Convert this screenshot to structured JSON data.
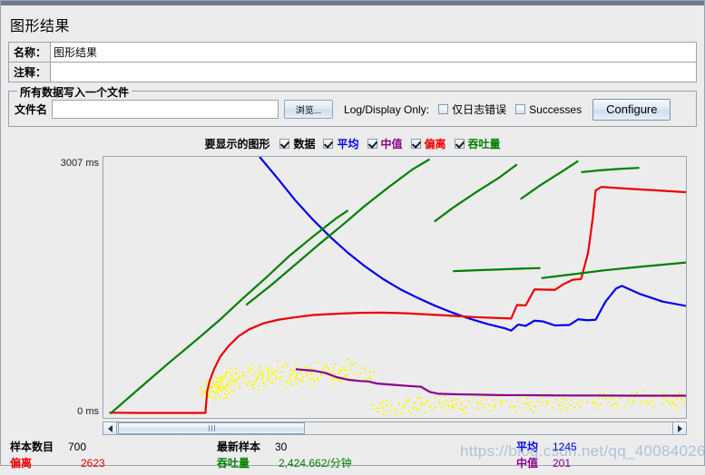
{
  "window": {
    "title": "图形结果"
  },
  "name_row": {
    "label": "名称：",
    "value": "图形结果"
  },
  "comment_row": {
    "label": "注释：",
    "value": ""
  },
  "file_group": {
    "title": "所有数据写入一个文件",
    "filename_label": "文件名",
    "filename_value": "",
    "filename_placeholder": "",
    "browse_label": "浏览...",
    "logdisplay_label": "Log/Display Only:",
    "errors_checkbox": {
      "label": "仅日志错误",
      "checked": false
    },
    "successes_checkbox": {
      "label": "Successes",
      "checked": false
    },
    "configure_label": "Configure"
  },
  "graph_select": {
    "title": "要显示的图形",
    "items": [
      {
        "label": "数据",
        "checked": true,
        "color": "#000000"
      },
      {
        "label": "平均",
        "checked": true,
        "color": "#0000ee"
      },
      {
        "label": "中值",
        "checked": true,
        "color": "#8b008b"
      },
      {
        "label": "偏离",
        "checked": true,
        "color": "#ee0000"
      },
      {
        "label": "吞吐量",
        "checked": true,
        "color": "#008000"
      }
    ]
  },
  "chart": {
    "y_top_label": "3007 ms",
    "y_bottom_label": "0 ms"
  },
  "chart_data": {
    "type": "line",
    "title": "图形结果",
    "xlabel": "",
    "ylabel": "ms",
    "ylim": [
      0,
      3007
    ],
    "yticks": [
      0,
      3007
    ],
    "ytick_labels": [
      "0 ms",
      "3007 ms"
    ],
    "grid": false,
    "legend": "top",
    "x_range_samples": [
      1,
      700
    ],
    "series": [
      {
        "name": "数据",
        "color": "#ffff00",
        "style": "scatter",
        "final_value": 30,
        "points": [
          [
            0.175,
            330
          ],
          [
            0.178,
            300
          ],
          [
            0.181,
            360
          ],
          [
            0.186,
            420
          ],
          [
            0.19,
            300
          ],
          [
            0.194,
            380
          ],
          [
            0.198,
            430
          ],
          [
            0.202,
            350
          ],
          [
            0.206,
            480
          ],
          [
            0.21,
            400
          ],
          [
            0.214,
            300
          ],
          [
            0.218,
            450
          ],
          [
            0.225,
            520
          ],
          [
            0.232,
            470
          ],
          [
            0.24,
            430
          ],
          [
            0.248,
            560
          ],
          [
            0.256,
            400
          ],
          [
            0.264,
            490
          ],
          [
            0.272,
            540
          ],
          [
            0.28,
            450
          ],
          [
            0.288,
            520
          ],
          [
            0.296,
            480
          ],
          [
            0.305,
            600
          ],
          [
            0.313,
            430
          ],
          [
            0.321,
            510
          ],
          [
            0.33,
            470
          ],
          [
            0.338,
            560
          ],
          [
            0.347,
            500
          ],
          [
            0.356,
            540
          ],
          [
            0.365,
            460
          ],
          [
            0.375,
            580
          ],
          [
            0.385,
            520
          ],
          [
            0.395,
            470
          ],
          [
            0.405,
            560
          ],
          [
            0.415,
            500
          ],
          [
            0.425,
            620
          ],
          [
            0.44,
            520
          ],
          [
            0.455,
            480
          ],
          [
            0.47,
            120
          ],
          [
            0.485,
            150
          ],
          [
            0.5,
            110
          ],
          [
            0.515,
            160
          ],
          [
            0.53,
            130
          ],
          [
            0.545,
            180
          ],
          [
            0.56,
            140
          ],
          [
            0.575,
            200
          ],
          [
            0.59,
            150
          ],
          [
            0.605,
            170
          ],
          [
            0.62,
            130
          ],
          [
            0.64,
            190
          ],
          [
            0.66,
            160
          ],
          [
            0.68,
            210
          ],
          [
            0.7,
            150
          ],
          [
            0.72,
            180
          ],
          [
            0.74,
            140
          ],
          [
            0.76,
            200
          ],
          [
            0.78,
            170
          ],
          [
            0.8,
            160
          ],
          [
            0.82,
            210
          ],
          [
            0.84,
            190
          ],
          [
            0.86,
            230
          ],
          [
            0.88,
            180
          ],
          [
            0.9,
            220
          ],
          [
            0.92,
            260
          ],
          [
            0.94,
            200
          ],
          [
            0.96,
            240
          ],
          [
            0.975,
            190
          ],
          [
            0.99,
            230
          ]
        ]
      },
      {
        "name": "平均",
        "color": "#0000ee",
        "style": "line",
        "final_value": 1245,
        "points": [
          [
            0.268,
            3007
          ],
          [
            0.3,
            2750
          ],
          [
            0.33,
            2500
          ],
          [
            0.36,
            2280
          ],
          [
            0.39,
            2080
          ],
          [
            0.42,
            1900
          ],
          [
            0.45,
            1740
          ],
          [
            0.48,
            1600
          ],
          [
            0.51,
            1480
          ],
          [
            0.54,
            1380
          ],
          [
            0.57,
            1290
          ],
          [
            0.6,
            1210
          ],
          [
            0.63,
            1140
          ],
          [
            0.66,
            1080
          ],
          [
            0.69,
            1030
          ],
          [
            0.7,
            1005
          ],
          [
            0.712,
            1075
          ],
          [
            0.725,
            1060
          ],
          [
            0.74,
            1120
          ],
          [
            0.755,
            1110
          ],
          [
            0.775,
            1065
          ],
          [
            0.8,
            1070
          ],
          [
            0.815,
            1135
          ],
          [
            0.83,
            1125
          ],
          [
            0.845,
            1130
          ],
          [
            0.862,
            1340
          ],
          [
            0.88,
            1490
          ],
          [
            0.89,
            1520
          ],
          [
            0.92,
            1430
          ],
          [
            0.96,
            1340
          ],
          [
            1.0,
            1290
          ]
        ]
      },
      {
        "name": "中值",
        "color": "#8b008b",
        "style": "line",
        "final_value": 201,
        "points": [
          [
            0.33,
            560
          ],
          [
            0.36,
            545
          ],
          [
            0.38,
            520
          ],
          [
            0.4,
            470
          ],
          [
            0.42,
            440
          ],
          [
            0.44,
            425
          ],
          [
            0.455,
            420
          ],
          [
            0.47,
            395
          ],
          [
            0.5,
            380
          ],
          [
            0.53,
            365
          ],
          [
            0.545,
            360
          ],
          [
            0.56,
            300
          ],
          [
            0.575,
            278
          ],
          [
            0.6,
            272
          ],
          [
            0.64,
            268
          ],
          [
            0.66,
            265
          ],
          [
            0.69,
            262
          ],
          [
            0.72,
            262
          ],
          [
            0.76,
            260
          ],
          [
            0.8,
            258
          ],
          [
            0.85,
            258
          ],
          [
            0.9,
            256
          ],
          [
            0.95,
            256
          ],
          [
            1.0,
            255
          ]
        ]
      },
      {
        "name": "偏离",
        "color": "#ee0000",
        "style": "line",
        "final_value": 2623,
        "points": [
          [
            0.01,
            60
          ],
          [
            0.06,
            58
          ],
          [
            0.12,
            58
          ],
          [
            0.175,
            58
          ],
          [
            0.178,
            300
          ],
          [
            0.182,
            420
          ],
          [
            0.19,
            560
          ],
          [
            0.2,
            700
          ],
          [
            0.215,
            830
          ],
          [
            0.232,
            940
          ],
          [
            0.25,
            1020
          ],
          [
            0.275,
            1090
          ],
          [
            0.3,
            1130
          ],
          [
            0.33,
            1160
          ],
          [
            0.36,
            1185
          ],
          [
            0.4,
            1200
          ],
          [
            0.44,
            1210
          ],
          [
            0.48,
            1212
          ],
          [
            0.52,
            1205
          ],
          [
            0.56,
            1190
          ],
          [
            0.6,
            1175
          ],
          [
            0.64,
            1160
          ],
          [
            0.68,
            1150
          ],
          [
            0.7,
            1145
          ],
          [
            0.71,
            1300
          ],
          [
            0.725,
            1295
          ],
          [
            0.74,
            1480
          ],
          [
            0.775,
            1475
          ],
          [
            0.79,
            1540
          ],
          [
            0.805,
            1590
          ],
          [
            0.82,
            1600
          ],
          [
            0.832,
            1900
          ],
          [
            0.84,
            2300
          ],
          [
            0.845,
            2620
          ],
          [
            0.855,
            2660
          ],
          [
            0.9,
            2640
          ],
          [
            1.0,
            2600
          ]
        ]
      },
      {
        "name": "吞吐量",
        "color": "#008000",
        "style": "line",
        "final_value": "2,424.662/分钟",
        "segments": [
          [
            [
              0.012,
              50
            ],
            [
              0.06,
              330
            ],
            [
              0.11,
              620
            ],
            [
              0.16,
              900
            ],
            [
              0.2,
              1130
            ],
            [
              0.24,
              1380
            ],
            [
              0.28,
              1620
            ],
            [
              0.32,
              1870
            ],
            [
              0.36,
              2090
            ],
            [
              0.4,
              2300
            ],
            [
              0.42,
              2390
            ]
          ],
          [
            [
              0.245,
              1300
            ],
            [
              0.29,
              1540
            ],
            [
              0.33,
              1770
            ],
            [
              0.37,
              2000
            ],
            [
              0.41,
              2220
            ],
            [
              0.45,
              2450
            ],
            [
              0.49,
              2660
            ],
            [
              0.53,
              2860
            ],
            [
              0.56,
              2980
            ]
          ],
          [
            [
              0.568,
              2260
            ],
            [
              0.6,
              2420
            ],
            [
              0.64,
              2600
            ],
            [
              0.68,
              2770
            ],
            [
              0.71,
              2920
            ]
          ],
          [
            [
              0.716,
              2520
            ],
            [
              0.75,
              2680
            ],
            [
              0.79,
              2850
            ],
            [
              0.815,
              2960
            ]
          ],
          [
            [
              0.82,
              2830
            ],
            [
              0.85,
              2850
            ],
            [
              0.89,
              2870
            ],
            [
              0.92,
              2880
            ]
          ],
          [
            [
              0.6,
              1690
            ],
            [
              0.64,
              1700
            ],
            [
              0.68,
              1710
            ],
            [
              0.72,
              1720
            ],
            [
              0.75,
              1725
            ]
          ],
          [
            [
              0.752,
              1610
            ],
            [
              0.8,
              1650
            ],
            [
              0.86,
              1700
            ],
            [
              0.92,
              1740
            ],
            [
              1.0,
              1790
            ]
          ]
        ]
      }
    ]
  },
  "scrollbar": {
    "left_arrow": "◀",
    "right_arrow": "▶"
  },
  "stats": {
    "columns": [
      {
        "rows": [
          {
            "key": "样本数目",
            "value": "700",
            "key_color": "#000000",
            "value_color": "#000000"
          },
          {
            "key": "偏离",
            "value": "2623",
            "key_color": "#ee0000",
            "value_color": "#ee0000"
          }
        ]
      },
      {
        "rows": [
          {
            "key": "最新样本",
            "value": "30",
            "key_color": "#000000",
            "value_color": "#000000"
          },
          {
            "key": "吞吐量",
            "value": "2,424.662/分钟",
            "key_color": "#008000",
            "value_color": "#008000"
          }
        ]
      },
      {
        "rows": [
          {
            "key": "平均",
            "value": "1245",
            "key_color": "#0000ee",
            "value_color": "#0000ee"
          },
          {
            "key": "中值",
            "value": "201",
            "key_color": "#8b008b",
            "value_color": "#8b008b"
          }
        ]
      }
    ]
  },
  "watermark": {
    "text": "https://blog.csdn.net/qq_40084026"
  }
}
